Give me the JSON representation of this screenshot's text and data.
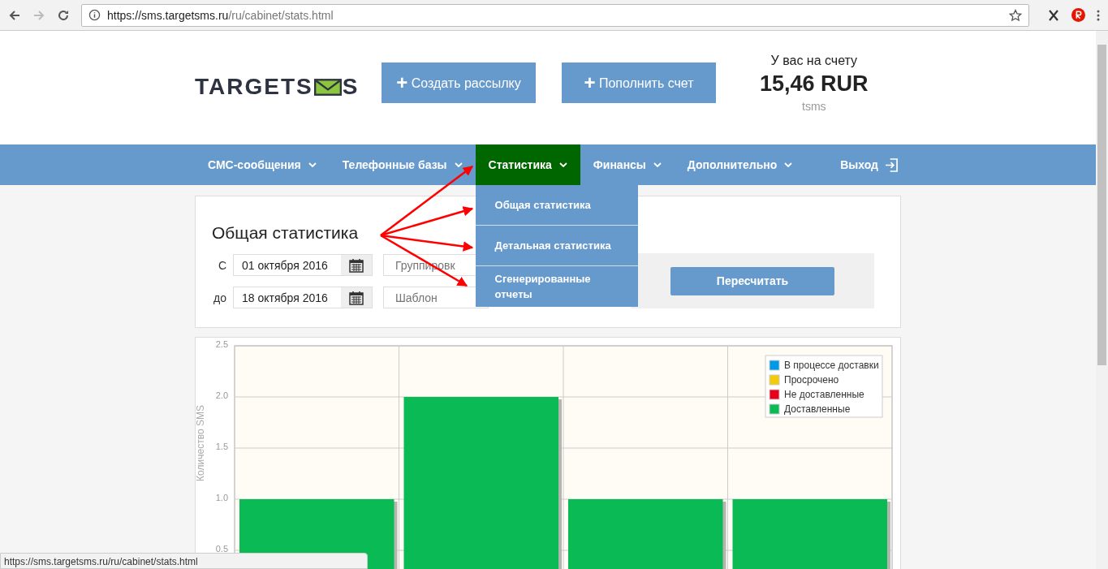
{
  "browser": {
    "url_host": "https://sms.targetsms.ru",
    "url_path": "/ru/cabinet/stats.html",
    "status_url": "https://sms.targetsms.ru/ru/cabinet/stats.html"
  },
  "logo": {
    "left": "TARGETS",
    "right": "S"
  },
  "header_buttons": [
    {
      "icon": "+",
      "label": "Создать рассылку"
    },
    {
      "icon": "+",
      "label": "Пополнить счет"
    }
  ],
  "balance": {
    "label": "У вас на счету",
    "amount": "15,46 RUR",
    "unit": "tsms"
  },
  "nav": {
    "items": [
      {
        "label": "СМС-сообщения",
        "selected": false
      },
      {
        "label": "Телефонные базы",
        "selected": false
      },
      {
        "label": "Статистика",
        "selected": true
      },
      {
        "label": "Финансы",
        "selected": false
      },
      {
        "label": "Дополнительно",
        "selected": false
      }
    ],
    "logout": "Выход",
    "dropdown": [
      "Общая статистика",
      "Детальная статистика",
      "Сгенерированные отчеты"
    ]
  },
  "filter": {
    "title": "Общая статистика",
    "from_label": "С",
    "from_value": "01 октября 2016",
    "to_label": "до",
    "to_value": "18 октября 2016",
    "grouping_placeholder": "Группировк",
    "template_placeholder": "Шаблон",
    "button": "Пересчитать"
  },
  "chart": {
    "chart_data": {
      "type": "bar",
      "ylabel": "Количество SMS",
      "stacked": true,
      "grid": true,
      "ylim": [
        0,
        2.5
      ],
      "yticks": [
        {
          "value": 0.5,
          "label": "0.5"
        },
        {
          "value": 1,
          "label": "1.0"
        },
        {
          "value": 1.5,
          "label": "1.5"
        },
        {
          "value": 2,
          "label": "2.0"
        },
        {
          "value": 2.5,
          "label": "2.5"
        }
      ],
      "series": [
        {
          "name": "В процессе доставки",
          "color": "#0099e6",
          "values": [
            0,
            0,
            0,
            0
          ]
        },
        {
          "name": "Просрочено",
          "color": "#f2cc0c",
          "values": [
            0,
            0,
            0,
            0
          ]
        },
        {
          "name": "Не доставленные",
          "color": "#e6001a",
          "values": [
            0,
            0,
            0,
            0
          ]
        },
        {
          "name": "Доставленные",
          "color": "#0abb55",
          "values": [
            1,
            2,
            1,
            1
          ]
        }
      ]
    }
  }
}
